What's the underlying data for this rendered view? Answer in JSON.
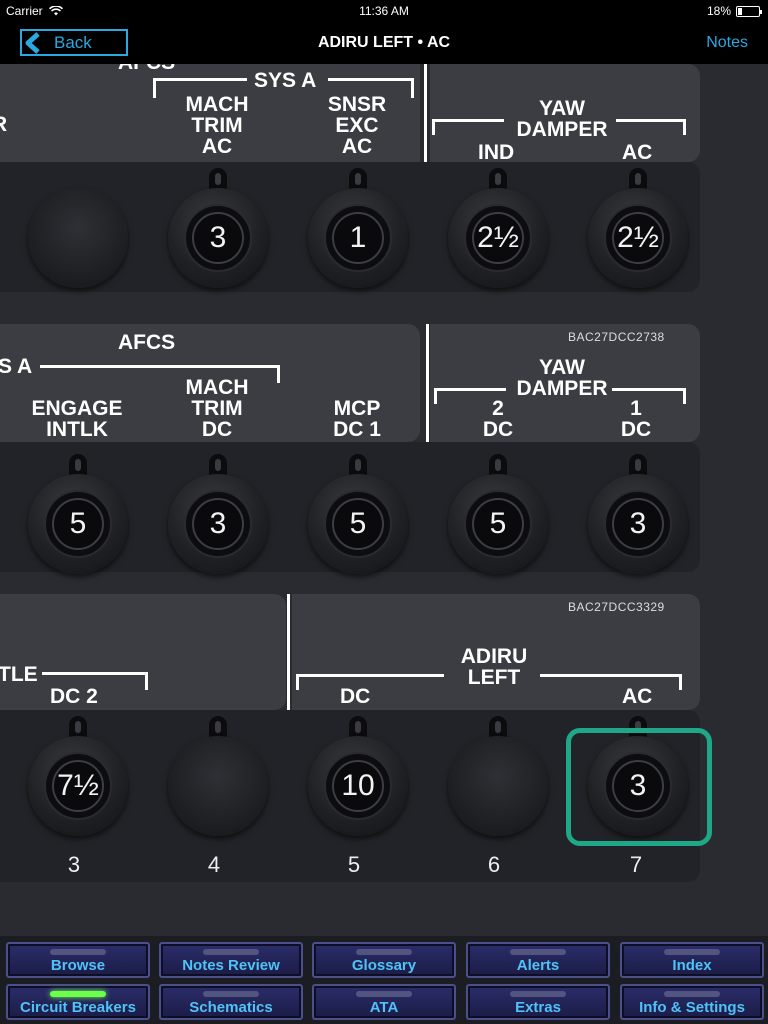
{
  "status": {
    "carrier": "Carrier",
    "time": "11:36 AM",
    "battery": "18%",
    "battery_level": 0.18
  },
  "nav": {
    "back_label": "Back",
    "title": "ADIRU LEFT • AC",
    "notes_label": "Notes"
  },
  "panel": {
    "row1": {
      "labels": {
        "afcs_partial": "AFCS",
        "sys_a": "SYS A",
        "mach_trim_ac": "MACH\nTRIM\nAC",
        "snsr_exc_ac": "SNSR\nEXC\nAC",
        "yaw_damper": "YAW\nDAMPER",
        "ind": "IND",
        "ac": "AC",
        "edge_r": "R"
      },
      "breakers": [
        "",
        "3",
        "1",
        "2½",
        "2½"
      ]
    },
    "row2": {
      "code": "BAC27DCC2738",
      "labels": {
        "afcs": "AFCS",
        "sys_a_partial": "S A",
        "engage_intlk": "ENGAGE\nINTLK",
        "mach_trim_dc": "MACH\nTRIM\nDC",
        "mcp_dc1": "MCP\nDC 1",
        "yaw_damper": "YAW\nDAMPER",
        "dc2": "2\nDC",
        "dc1": "1\nDC"
      },
      "breakers": [
        "5",
        "3",
        "5",
        "5",
        "3"
      ]
    },
    "row3": {
      "code": "BAC27DCC3329",
      "labels": {
        "tle_partial": "TLE",
        "dc2": "DC 2",
        "adiru_left": "ADIRU\nLEFT",
        "dc": "DC",
        "ac": "AC"
      },
      "breakers": [
        "7½",
        "",
        "10",
        "",
        "3"
      ],
      "slot_numbers": [
        "3",
        "4",
        "5",
        "6",
        "7"
      ]
    }
  },
  "tabs": [
    {
      "label": "Browse",
      "active": false
    },
    {
      "label": "Notes Review",
      "active": false
    },
    {
      "label": "Glossary",
      "active": false
    },
    {
      "label": "Alerts",
      "active": false
    },
    {
      "label": "Index",
      "active": false
    },
    {
      "label": "Circuit Breakers",
      "active": true
    },
    {
      "label": "Schematics",
      "active": false
    },
    {
      "label": "ATA",
      "active": false
    },
    {
      "label": "Extras",
      "active": false
    },
    {
      "label": "Info & Settings",
      "active": false
    }
  ],
  "colors": {
    "accent": "#2ba8e0",
    "highlight": "#1ea888",
    "tab_text": "#4fc3f7",
    "tab_active_indicator": "#6cff4c"
  },
  "icons": {
    "back": "chevron-left-icon",
    "wifi": "wifi-icon",
    "battery": "battery-icon"
  }
}
